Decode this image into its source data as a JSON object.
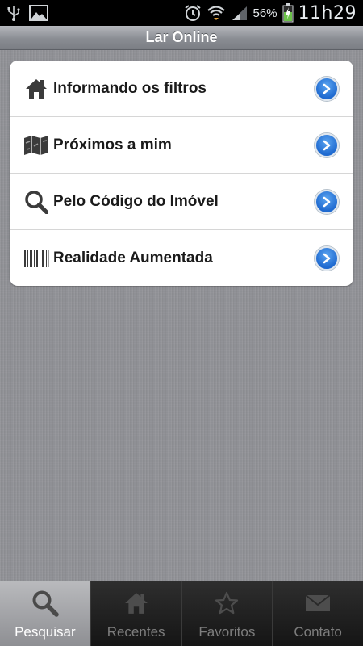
{
  "status_bar": {
    "battery_percent": "56%",
    "time": "11h29",
    "icons": [
      "usb-icon",
      "image-icon",
      "alarm-icon",
      "wifi-icon",
      "signal-icon",
      "battery-charging-icon"
    ]
  },
  "header": {
    "title": "Lar Online"
  },
  "menu": {
    "items": [
      {
        "label": "Informando os filtros",
        "icon": "home-icon"
      },
      {
        "label": "Próximos a mim",
        "icon": "map-icon"
      },
      {
        "label": "Pelo Código do Imóvel",
        "icon": "search-icon"
      },
      {
        "label": "Realidade Aumentada",
        "icon": "barcode-icon"
      }
    ]
  },
  "tabs": [
    {
      "label": "Pesquisar",
      "icon": "search-icon",
      "active": true
    },
    {
      "label": "Recentes",
      "icon": "home-icon",
      "active": false
    },
    {
      "label": "Favoritos",
      "icon": "star-icon",
      "active": false
    },
    {
      "label": "Contato",
      "icon": "mail-icon",
      "active": false
    }
  ],
  "colors": {
    "accent": "#1f6ad0",
    "background": "#8f9095",
    "tab_bar": "#1c1c1c"
  }
}
